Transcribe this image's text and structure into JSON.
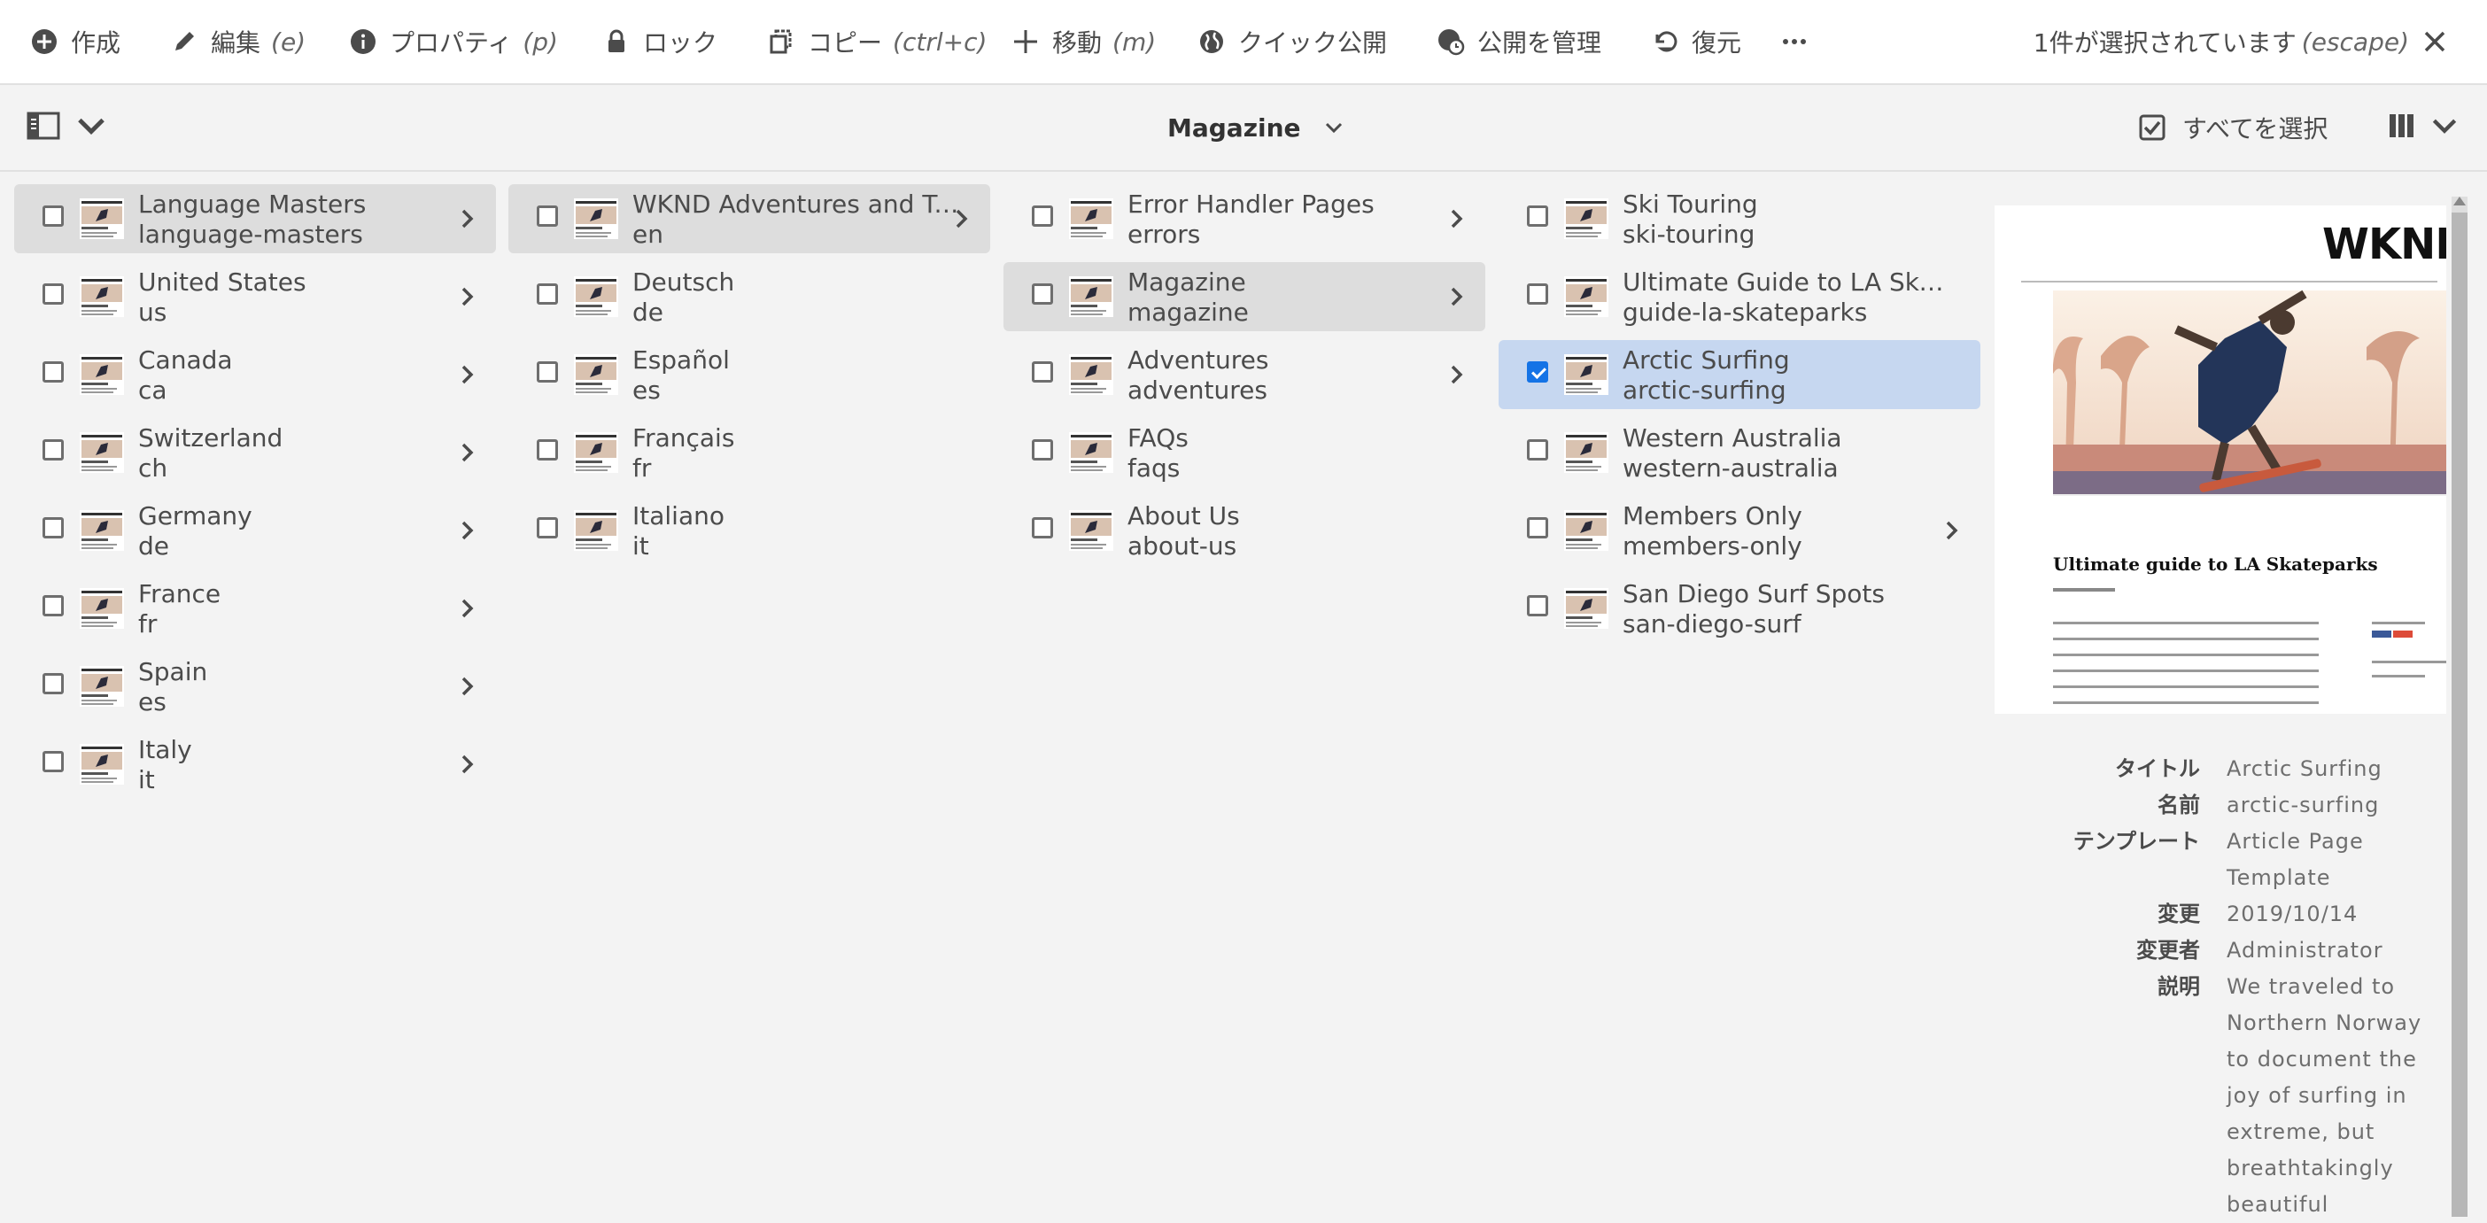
{
  "actionbar": {
    "create": "作成",
    "edit": "編集",
    "edit_key": "(e)",
    "properties": "プロパティ",
    "properties_key": "(p)",
    "lock": "ロック",
    "copy": "コピー",
    "copy_key": "(ctrl+c)",
    "move": "移動",
    "move_key": "(m)",
    "quick_publish": "クイック公開",
    "manage_publication": "公開を管理",
    "restore": "復元",
    "more": "…",
    "selection_text": "1件が選択されています",
    "selection_key": "(escape)"
  },
  "navbar": {
    "breadcrumb": "Magazine",
    "select_all": "すべてを選択"
  },
  "columns": [
    [
      {
        "title": "Language Masters",
        "name": "language-masters",
        "active": true,
        "has_children": true
      },
      {
        "title": "United States",
        "name": "us",
        "has_children": true
      },
      {
        "title": "Canada",
        "name": "ca",
        "has_children": true
      },
      {
        "title": "Switzerland",
        "name": "ch",
        "has_children": true
      },
      {
        "title": "Germany",
        "name": "de",
        "has_children": true
      },
      {
        "title": "France",
        "name": "fr",
        "has_children": true
      },
      {
        "title": "Spain",
        "name": "es",
        "has_children": true
      },
      {
        "title": "Italy",
        "name": "it",
        "has_children": true
      }
    ],
    [
      {
        "title": "WKND Adventures and Tr…",
        "name": "en",
        "active": true,
        "has_children": true
      },
      {
        "title": "Deutsch",
        "name": "de"
      },
      {
        "title": "Español",
        "name": "es"
      },
      {
        "title": "Français",
        "name": "fr"
      },
      {
        "title": "Italiano",
        "name": "it"
      }
    ],
    [
      {
        "title": "Error Handler Pages",
        "name": "errors",
        "has_children": true
      },
      {
        "title": "Magazine",
        "name": "magazine",
        "active": true,
        "has_children": true
      },
      {
        "title": "Adventures",
        "name": "adventures",
        "has_children": true
      },
      {
        "title": "FAQs",
        "name": "faqs"
      },
      {
        "title": "About Us",
        "name": "about-us"
      }
    ],
    [
      {
        "title": "Ski Touring",
        "name": "ski-touring"
      },
      {
        "title": "Ultimate Guide to LA Skat…",
        "name": "guide-la-skateparks"
      },
      {
        "title": "Arctic Surfing",
        "name": "arctic-surfing",
        "selected": true
      },
      {
        "title": "Western Australia",
        "name": "western-australia"
      },
      {
        "title": "Members Only",
        "name": "members-only",
        "has_children": true
      },
      {
        "title": "San Diego Surf Spots",
        "name": "san-diego-surf"
      }
    ]
  ],
  "preview": {
    "brand": "WKND S",
    "article_title": "Ultimate guide to LA Skateparks"
  },
  "meta": [
    {
      "label": "タイトル",
      "value": "Arctic Surfing"
    },
    {
      "label": "名前",
      "value": "arctic-surfing"
    },
    {
      "label": "テンプレート",
      "value": "Article Page Template"
    },
    {
      "label": "変更",
      "value": "2019/10/14"
    },
    {
      "label": "変更者",
      "value": "Administrator"
    },
    {
      "label": "説明",
      "value": "We traveled to Northern Norway to document the joy of surfing in extreme, but breathtakingly beautiful"
    }
  ],
  "colors": {
    "accent": "#1473e6",
    "selected_row": "#c6d7f0",
    "active_row": "#dddddd",
    "background": "#f3f3f3"
  }
}
